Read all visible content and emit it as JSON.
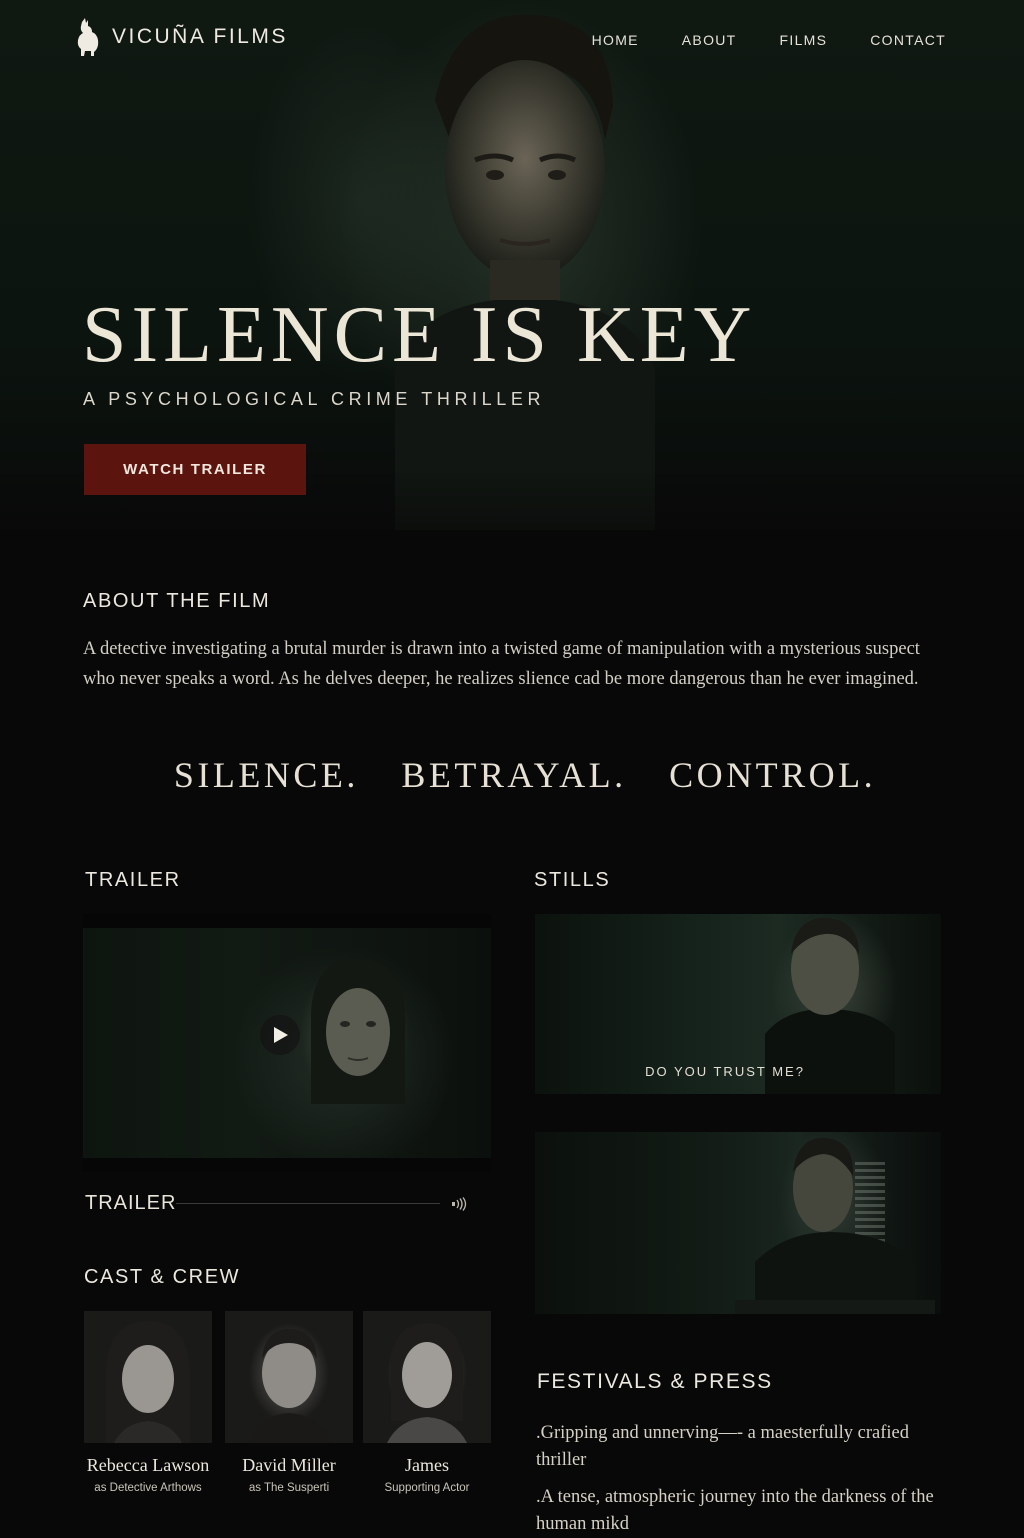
{
  "nav": {
    "brand": "VICUÑA FILMS",
    "links": [
      "HOME",
      "ABOUT",
      "FILMS",
      "CONTACT"
    ]
  },
  "hero": {
    "title": "SILENCE IS KEY",
    "subtitle": "A PSYCHOLOGICAL CRIME THRILLER",
    "cta": "WATCH TRAILER"
  },
  "about": {
    "heading": "ABOUT THE FILM",
    "text": "A detective investigating a brutal murder is drawn into a twisted game of manipulation with a mysterious suspect who never speaks a word. As he delves deeper, he realizes slience cad be more dangerous than he ever imagined."
  },
  "tagline": [
    "SILENCE.",
    "BETRAYAL.",
    "CONTROL."
  ],
  "trailer": {
    "heading": "TRAILER",
    "label": "TRAILER"
  },
  "stills": {
    "heading": "STILLS",
    "caption": "DO YOU TRUST ME?"
  },
  "cast": {
    "heading": "CAST & CREW",
    "members": [
      {
        "name": "Rebecca Lawson",
        "role": "as Detective Arthows"
      },
      {
        "name": "David Miller",
        "role": "as The Susperti"
      },
      {
        "name": "James",
        "role": "Supporting Actor"
      }
    ]
  },
  "press": {
    "heading": "FESTIVALS & PRESS",
    "quotes": [
      ".Gripping and unnerving—- a maesterfully crafied thriller",
      ".A tense, atmospheric journey into the darkness of the human mikd"
    ]
  },
  "colors": {
    "background": "#080808",
    "cta": "#5c140f",
    "text": "#e8e4da"
  }
}
